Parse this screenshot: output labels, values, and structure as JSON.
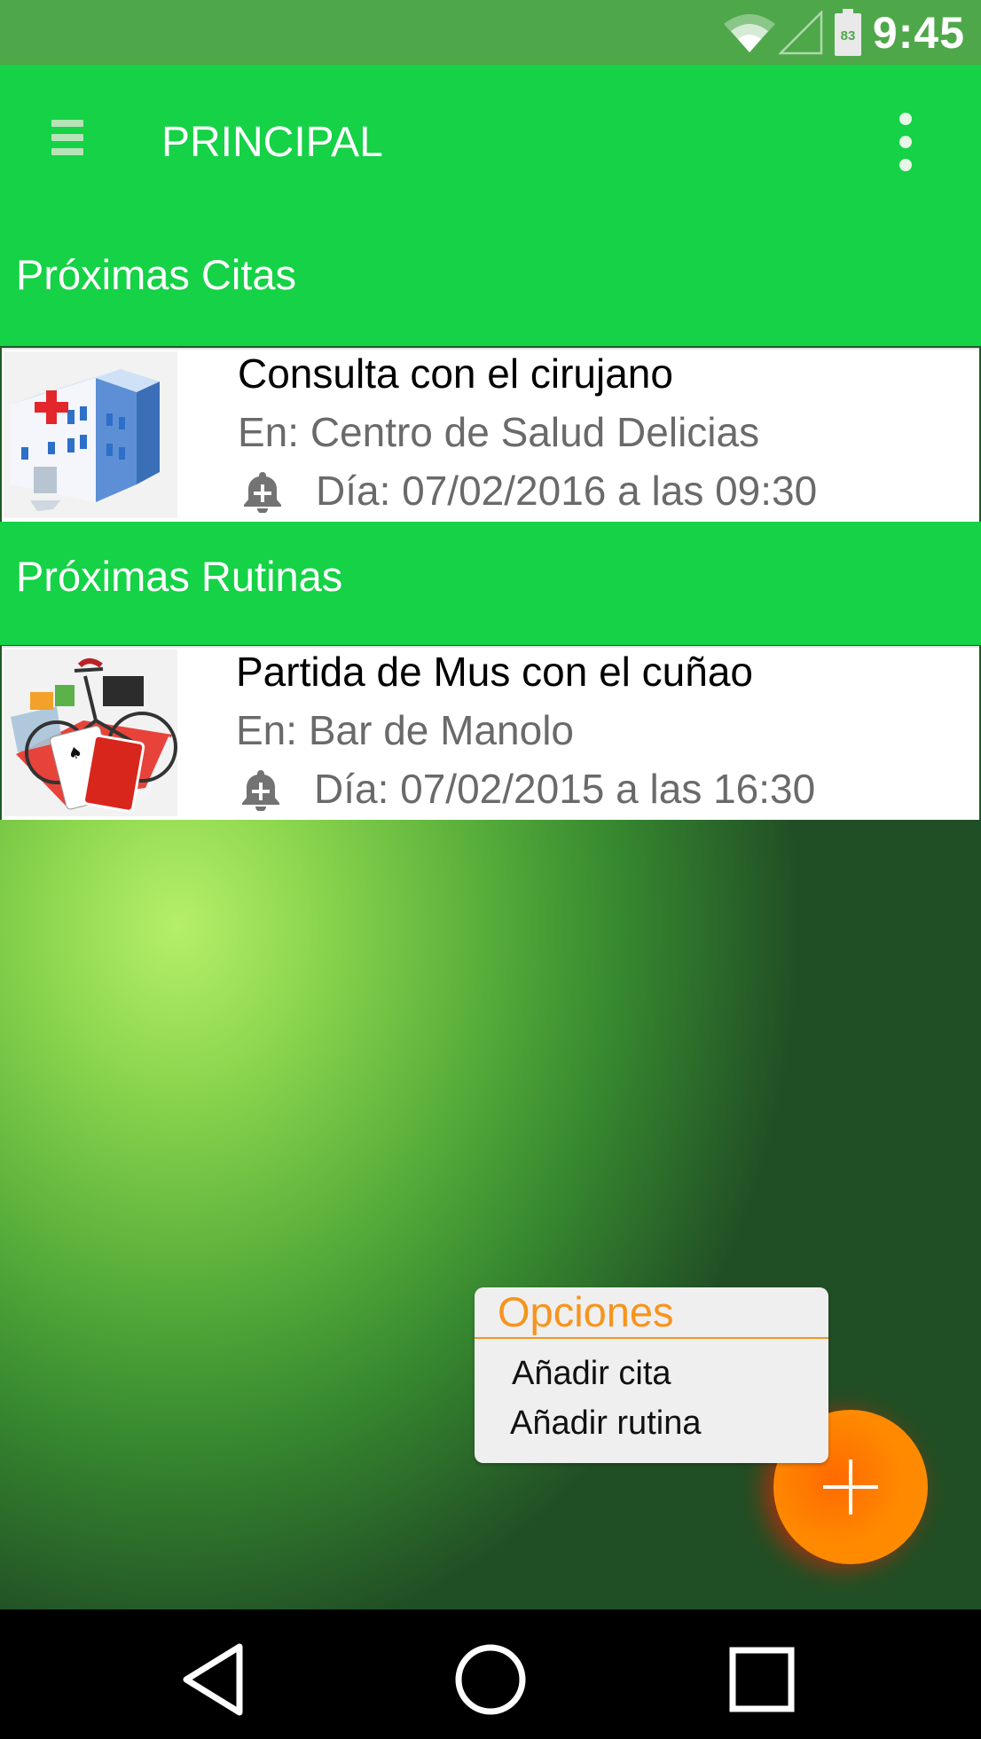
{
  "status_bar": {
    "time": "9:45",
    "battery_level": "83",
    "icons": [
      "wifi-icon",
      "signal-icon",
      "battery-icon"
    ]
  },
  "app_bar": {
    "title": "PRINCIPAL",
    "menu_icon": "hamburger-menu-icon",
    "overflow_icon": "more-vert-icon"
  },
  "sections": {
    "citas": {
      "title": "Próximas Citas",
      "item": {
        "title": "Consulta con el cirujano",
        "place": "En: Centro de Salud Delicias",
        "date": "Día: 07/02/2016 a las 09:30",
        "image_icon": "hospital-icon",
        "alarm_icon": "alarm-add-icon"
      }
    },
    "rutinas": {
      "title": "Próximas Rutinas",
      "item": {
        "title": "Partida de Mus con el cuñao",
        "place": "En: Bar de Manolo",
        "date": "Día: 07/02/2015 a las 16:30",
        "image_icon": "leisure-icon",
        "alarm_icon": "alarm-add-icon"
      }
    }
  },
  "popup_menu": {
    "title": "Opciones",
    "items": [
      "Añadir cita",
      "Añadir rutina"
    ]
  },
  "fab": {
    "icon": "plus-icon"
  },
  "nav_bar": {
    "icons": [
      "back-icon",
      "home-icon",
      "recents-icon"
    ]
  },
  "colors": {
    "status_bar": "#4ea84a",
    "app_bar": "#15d246",
    "popup_accent": "#f7941d",
    "fab": "#ff8c00"
  }
}
